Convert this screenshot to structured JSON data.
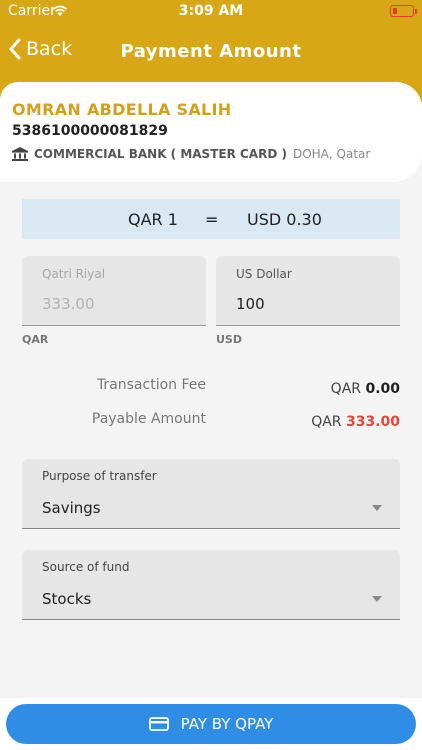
{
  "status": {
    "carrier": "Carrier",
    "time": "3:09 AM"
  },
  "nav": {
    "back": "Back",
    "title": "Payment Amount"
  },
  "beneficiary": {
    "name": "OMRAN ABDELLA SALIH",
    "account": "5386100000081829",
    "bank": "COMMERCIAL BANK ( MASTER CARD )",
    "location": "DOHA, Qatar"
  },
  "rate": {
    "left": "QAR 1",
    "equals": "=",
    "right": "USD 0.30"
  },
  "qar_field": {
    "label": "Qatri Riyal",
    "value": "333.00",
    "currency": "QAR"
  },
  "usd_field": {
    "label": "US Dollar",
    "value": "100",
    "currency": "USD"
  },
  "fee": {
    "label": "Transaction Fee",
    "currency": "QAR",
    "amount": "0.00"
  },
  "payable": {
    "label": "Payable Amount",
    "currency": "QAR",
    "amount": "333.00"
  },
  "purpose": {
    "label": "Purpose of transfer",
    "value": "Savings"
  },
  "source": {
    "label": "Source of fund",
    "value": "Stocks"
  },
  "pay_button": {
    "label": "PAY BY QPAY"
  },
  "colors": {
    "header": "#d8a716",
    "name": "#d1a01e",
    "rate_bg": "#dae8f3",
    "pay": "#2f8de6",
    "payable": "#e2463c"
  }
}
